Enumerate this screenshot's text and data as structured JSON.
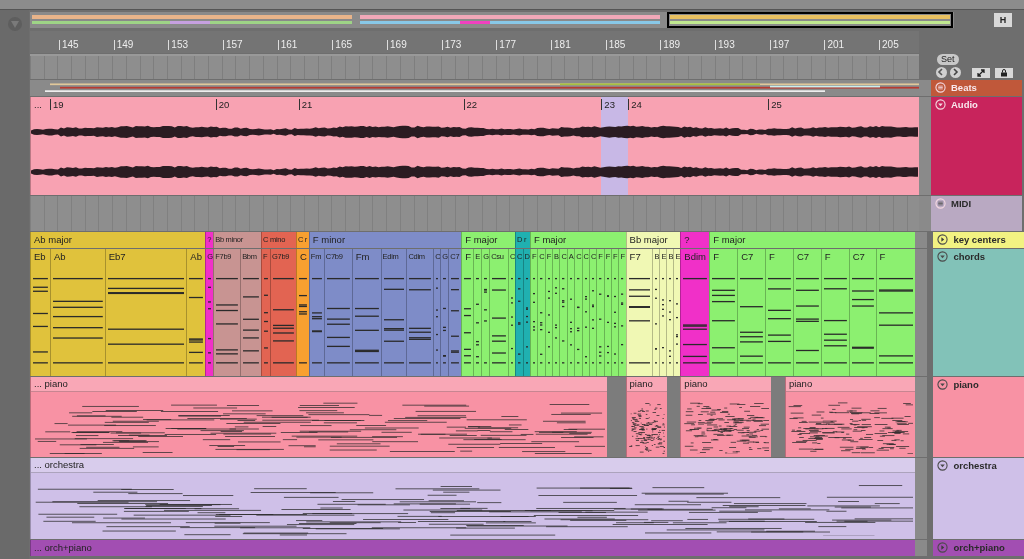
{
  "overview": {
    "buttons": [
      "H"
    ]
  },
  "ruler": {
    "bars": [
      "145",
      "149",
      "153",
      "157",
      "161",
      "165",
      "169",
      "173",
      "177",
      "181",
      "185",
      "189",
      "193",
      "197",
      "201",
      "205"
    ]
  },
  "locators": {
    "set_button": "Set"
  },
  "tracks": [
    {
      "name": "Beats",
      "kind": "group",
      "color": "#c0583a"
    },
    {
      "name": "Audio",
      "kind": "audio",
      "expanded": true,
      "color": "#c8245c",
      "clips": [
        {
          "label": "...",
          "color": "#f8a2b2",
          "markers": [
            {
              "label": "19",
              "selected": false
            },
            {
              "label": "20",
              "selected": false
            },
            {
              "label": "21",
              "selected": false
            },
            {
              "label": "22",
              "selected": false
            },
            {
              "label": "23",
              "selected": true
            },
            {
              "label": "24",
              "selected": false
            },
            {
              "label": "25",
              "selected": false
            }
          ]
        }
      ]
    },
    {
      "name": "MIDI",
      "kind": "group",
      "color": "#b9a9c2",
      "children": [
        {
          "name": "key centers",
          "kind": "midi",
          "expanded": false,
          "color": "#f2f282",
          "clips": [
            {
              "label": "Ab major",
              "color": "#e0c23c"
            },
            {
              "label": "?",
              "color": "#f030c8"
            },
            {
              "label": "Bb minor",
              "color": "#c89492"
            },
            {
              "label": "C mino",
              "color": "#e26452"
            },
            {
              "label": "C r",
              "color": "#f8a030"
            },
            {
              "label": "F minor",
              "color": "#7e8cc8"
            },
            {
              "label": "F major",
              "color": "#8cf070"
            },
            {
              "label": "D r",
              "color": "#20b0b0"
            },
            {
              "label": "F major",
              "color": "#8cf070"
            },
            {
              "label": "Bb major",
              "color": "#f0f8b4"
            },
            {
              "label": "?",
              "color": "#f030c8"
            },
            {
              "label": "F major",
              "color": "#8cf070"
            }
          ]
        },
        {
          "name": "chords",
          "kind": "midi",
          "expanded": true,
          "color": "#82c2b8",
          "clips": [
            {
              "label": "Eb",
              "color": "#e0c23c"
            },
            {
              "label": "Ab",
              "color": "#e0c23c"
            },
            {
              "label": "Eb7",
              "color": "#e0c23c"
            },
            {
              "label": "Ab",
              "color": "#e0c23c"
            },
            {
              "label": "G",
              "color": "#f030c8"
            },
            {
              "label": "F7b9",
              "color": "#c89492"
            },
            {
              "label": "Bbm",
              "color": "#c89492"
            },
            {
              "label": "F",
              "color": "#e26452"
            },
            {
              "label": "G7b9",
              "color": "#e26452"
            },
            {
              "label": "C",
              "color": "#f8a030"
            },
            {
              "label": "Fm",
              "color": "#7e8cc8"
            },
            {
              "label": "C7b9",
              "color": "#7e8cc8"
            },
            {
              "label": "Fm",
              "color": "#7e8cc8"
            },
            {
              "label": "Edim",
              "color": "#7e8cc8"
            },
            {
              "label": "Cdim",
              "color": "#7e8cc8"
            },
            {
              "label": "C",
              "color": "#7e8cc8"
            },
            {
              "label": "G",
              "color": "#7e8cc8"
            },
            {
              "label": "C7",
              "color": "#7e8cc8"
            },
            {
              "label": "F",
              "color": "#8cf070"
            },
            {
              "label": "E",
              "color": "#8cf070"
            },
            {
              "label": "G",
              "color": "#8cf070"
            },
            {
              "label": "Csu",
              "color": "#8cf070"
            },
            {
              "label": "C",
              "color": "#8cf070"
            },
            {
              "label": "C",
              "color": "#20b0b0"
            },
            {
              "label": "D",
              "color": "#20b0b0"
            },
            {
              "label": "F",
              "color": "#8cf070"
            },
            {
              "label": "C",
              "color": "#8cf070"
            },
            {
              "label": "F",
              "color": "#8cf070"
            },
            {
              "label": "B",
              "color": "#8cf070"
            },
            {
              "label": "C",
              "color": "#8cf070"
            },
            {
              "label": "A",
              "color": "#8cf070"
            },
            {
              "label": "C",
              "color": "#8cf070"
            },
            {
              "label": "C",
              "color": "#8cf070"
            },
            {
              "label": "C",
              "color": "#8cf070"
            },
            {
              "label": "F",
              "color": "#8cf070"
            },
            {
              "label": "F",
              "color": "#8cf070"
            },
            {
              "label": "F",
              "color": "#8cf070"
            },
            {
              "label": "F",
              "color": "#8cf070"
            },
            {
              "label": "F7",
              "color": "#f0f8b4"
            },
            {
              "label": "B",
              "color": "#f0f8b4"
            },
            {
              "label": "E",
              "color": "#f0f8b4"
            },
            {
              "label": "B",
              "color": "#f0f8b4"
            },
            {
              "label": "E",
              "color": "#f0f8b4"
            },
            {
              "label": "Bdim",
              "color": "#f030c8"
            },
            {
              "label": "F",
              "color": "#8cf070"
            },
            {
              "label": "C7",
              "color": "#8cf070"
            },
            {
              "label": "F",
              "color": "#8cf070"
            },
            {
              "label": "C7",
              "color": "#8cf070"
            },
            {
              "label": "F",
              "color": "#8cf070"
            },
            {
              "label": "C7",
              "color": "#8cf070"
            },
            {
              "label": "F",
              "color": "#8cf070"
            }
          ]
        },
        {
          "name": "piano",
          "kind": "midi",
          "expanded": true,
          "color": "#f892a4",
          "clips": [
            {
              "label": "... piano"
            },
            {
              "label": "piano"
            },
            {
              "label": "piano"
            },
            {
              "label": "piano"
            }
          ]
        },
        {
          "name": "orchestra",
          "kind": "midi",
          "expanded": true,
          "color": "#cfc0e8",
          "clips": [
            {
              "label": "... orchestra"
            }
          ]
        },
        {
          "name": "orch+piano",
          "kind": "midi",
          "expanded": false,
          "color": "#a24eb2",
          "clips": [
            {
              "label": "... orch+piano"
            }
          ]
        }
      ]
    }
  ]
}
